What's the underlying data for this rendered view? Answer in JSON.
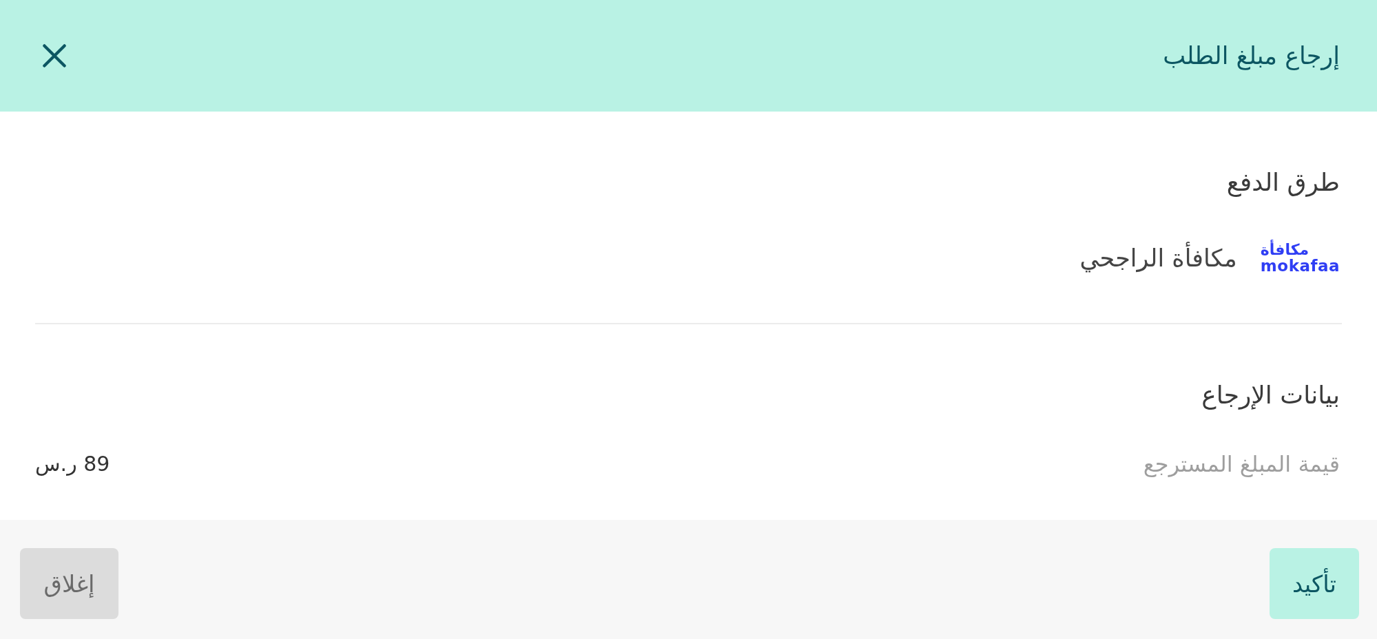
{
  "header": {
    "title": "إرجاع مبلغ الطلب"
  },
  "payment_methods": {
    "heading": "طرق الدفع",
    "items": [
      {
        "logo": {
          "line_1": "مكافأة",
          "line_2": "mokafaa"
        },
        "name": "مكافأة الراجحي"
      }
    ]
  },
  "refund_details": {
    "heading": "بيانات الإرجاع",
    "fields": [
      {
        "label": "قيمة المبلغ المسترجع",
        "value": "89 ر.س"
      }
    ]
  },
  "footer": {
    "buttons": [
      {
        "label": "تأكيد",
        "kind": "primary"
      },
      {
        "label": "إغلاق",
        "kind": "secondary"
      }
    ]
  }
}
